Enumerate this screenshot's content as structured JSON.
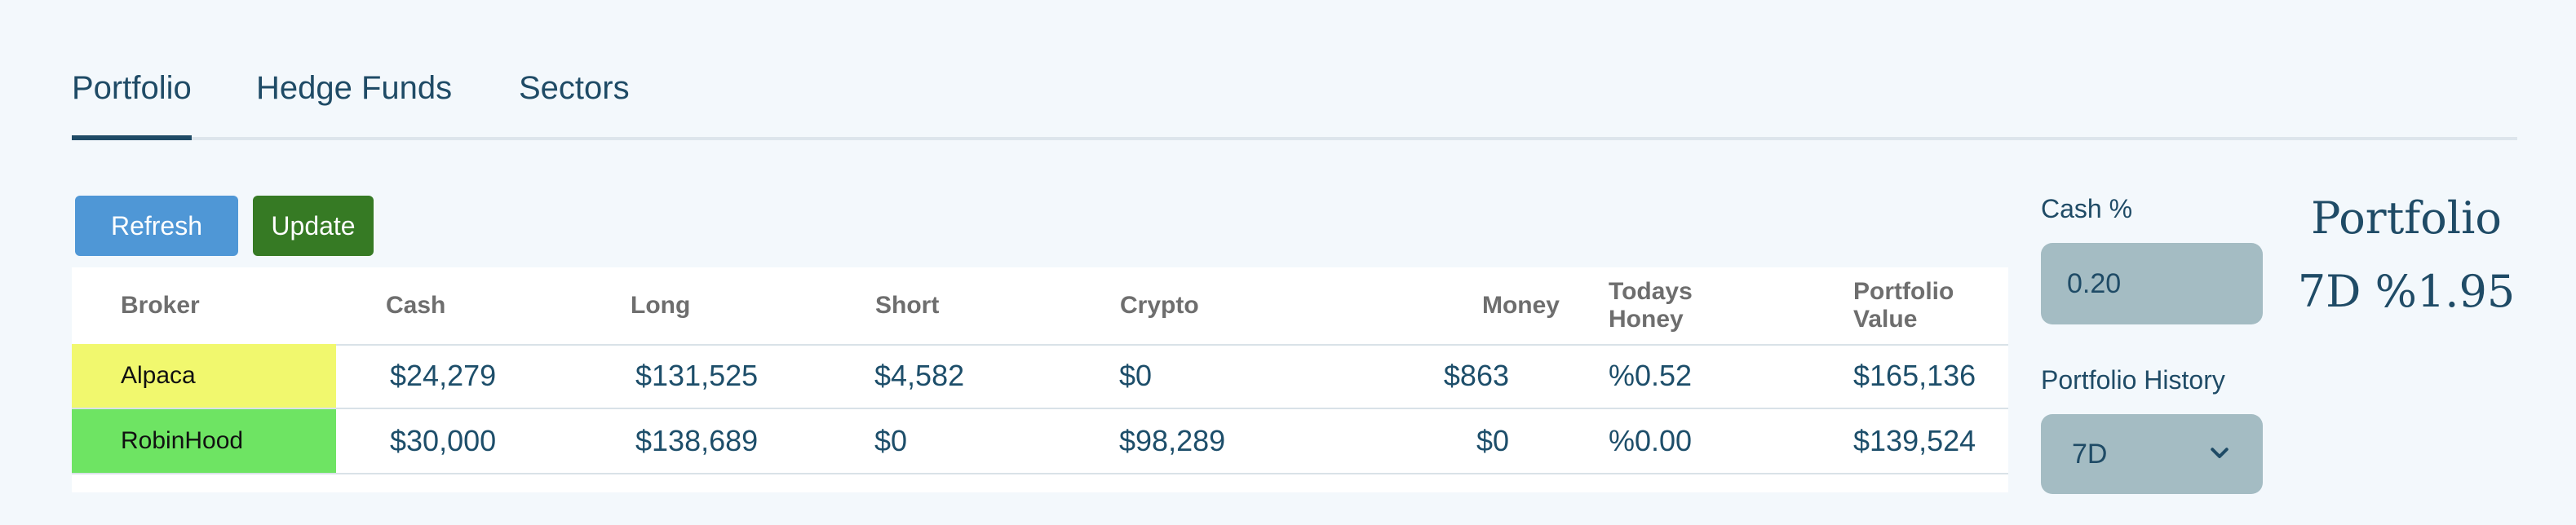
{
  "tabs": [
    {
      "label": "Portfolio",
      "active": true
    },
    {
      "label": "Hedge Funds",
      "active": false
    },
    {
      "label": "Sectors",
      "active": false
    }
  ],
  "buttons": {
    "refresh_label": "Refresh",
    "update_label": "Update"
  },
  "table": {
    "headers": {
      "broker": "Broker",
      "cash": "Cash",
      "long": "Long",
      "short": "Short",
      "crypto": "Crypto",
      "money": "Money",
      "todays_honey_line1": "Todays",
      "todays_honey_line2": "Honey",
      "portfolio_value_line1": "Portfolio",
      "portfolio_value_line2": "Value"
    },
    "rows": [
      {
        "broker": "Alpaca",
        "cash": "$24,279",
        "long": "$131,525",
        "short": "$4,582",
        "crypto": "$0",
        "money": "$863",
        "todays_honey": "%0.52",
        "portfolio_value": "$165,136"
      },
      {
        "broker": "RobinHood",
        "cash": "$30,000",
        "long": "$138,689",
        "short": "$0",
        "crypto": "$98,289",
        "money": "$0",
        "todays_honey": "%0.00",
        "portfolio_value": "$139,524"
      }
    ]
  },
  "cash_pct": {
    "label": "Cash %",
    "value": "0.20"
  },
  "portfolio_history": {
    "label": "Portfolio History",
    "selected": "7D"
  },
  "summary": {
    "title": "Portfolio",
    "change": "7D %1.95"
  },
  "colors": {
    "accent_blue": "#4f97d6",
    "accent_green": "#367a24",
    "alpaca_row": "#f1f86e",
    "robinhood_row": "#6ee463",
    "text_primary": "#1f4b66"
  },
  "icons": {
    "history_dropdown": "chevron-down-icon"
  }
}
